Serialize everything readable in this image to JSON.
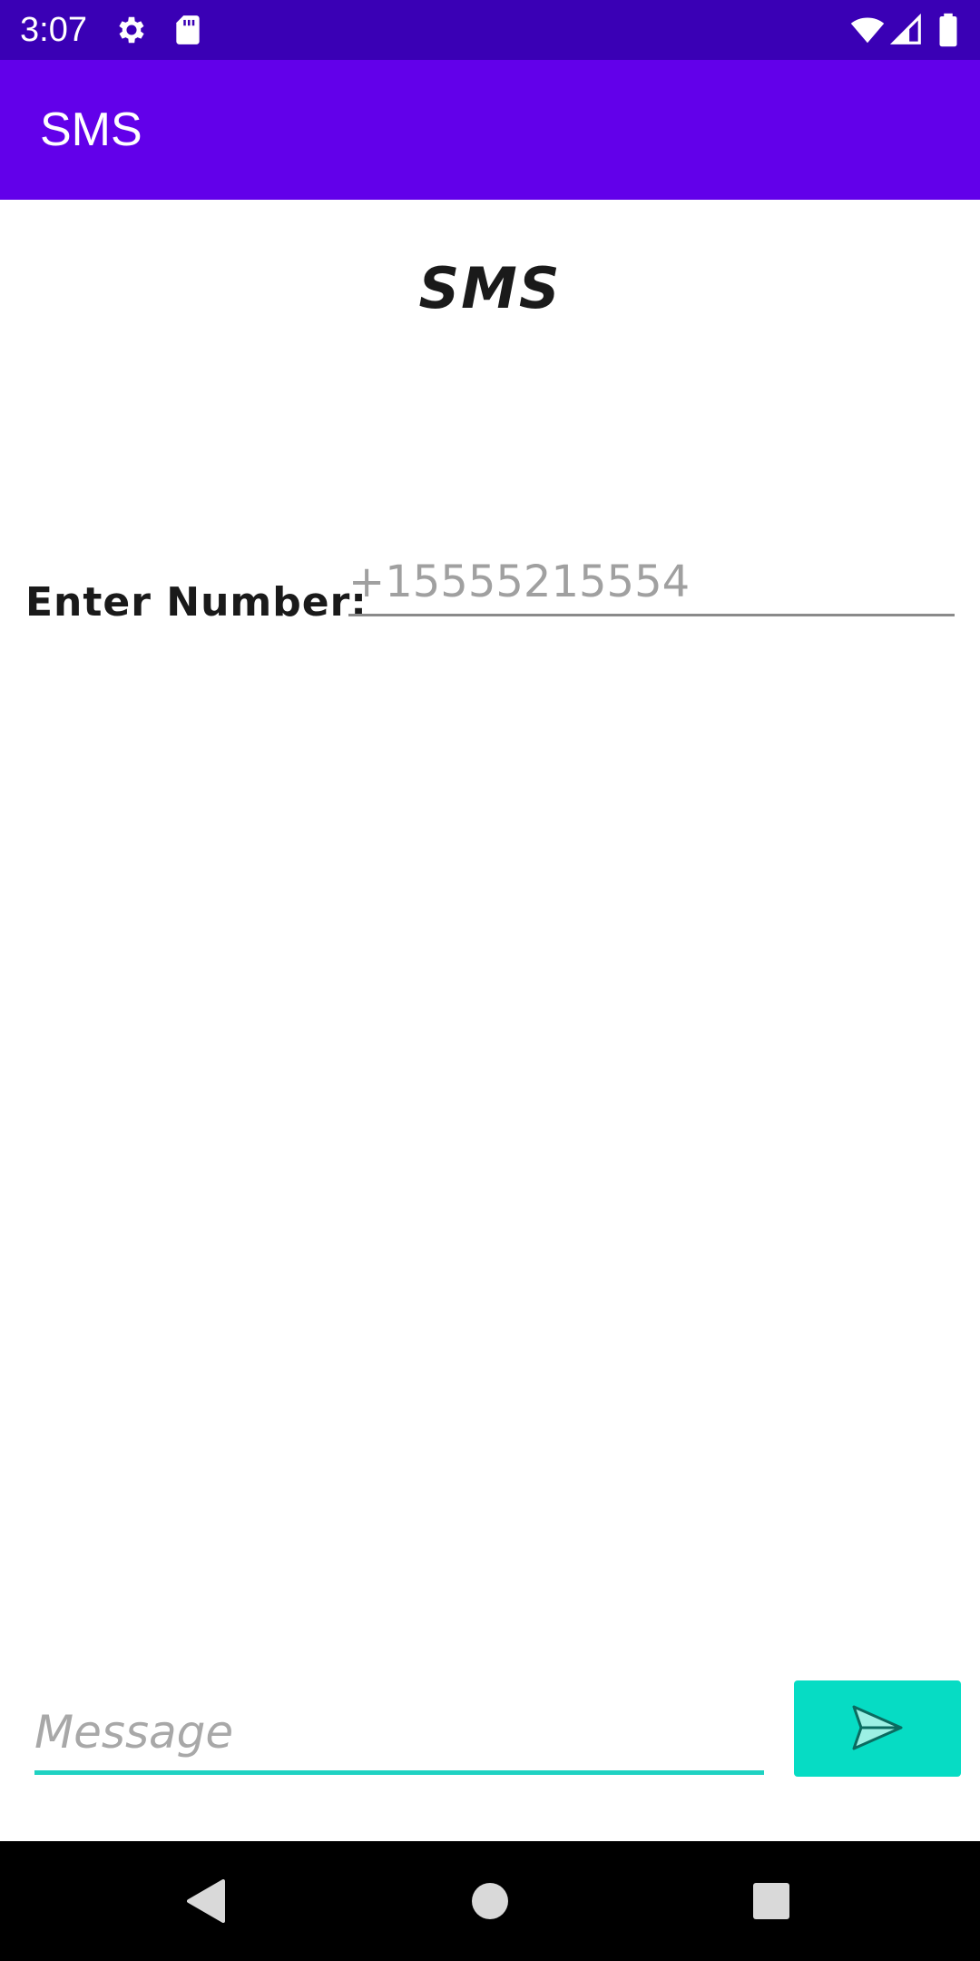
{
  "status_bar": {
    "time": "3:07",
    "background": "#3a00b5",
    "icons": [
      "settings-gear-icon",
      "sd-card-icon",
      "wifi-icon",
      "signal-icon",
      "battery-icon"
    ]
  },
  "app_bar": {
    "title": "SMS",
    "background": "#6200ea"
  },
  "main": {
    "heading": "SMS",
    "number_label": "Enter Number:",
    "number_input": {
      "placeholder": "+15555215554",
      "value": ""
    },
    "message_input": {
      "placeholder": "Message",
      "value": "",
      "underline_color": "#1fd2c2"
    },
    "send_button": {
      "icon": "send-icon",
      "background": "#06dcc4"
    }
  },
  "nav_bar": {
    "buttons": [
      "back-icon",
      "home-icon",
      "recents-icon"
    ]
  }
}
